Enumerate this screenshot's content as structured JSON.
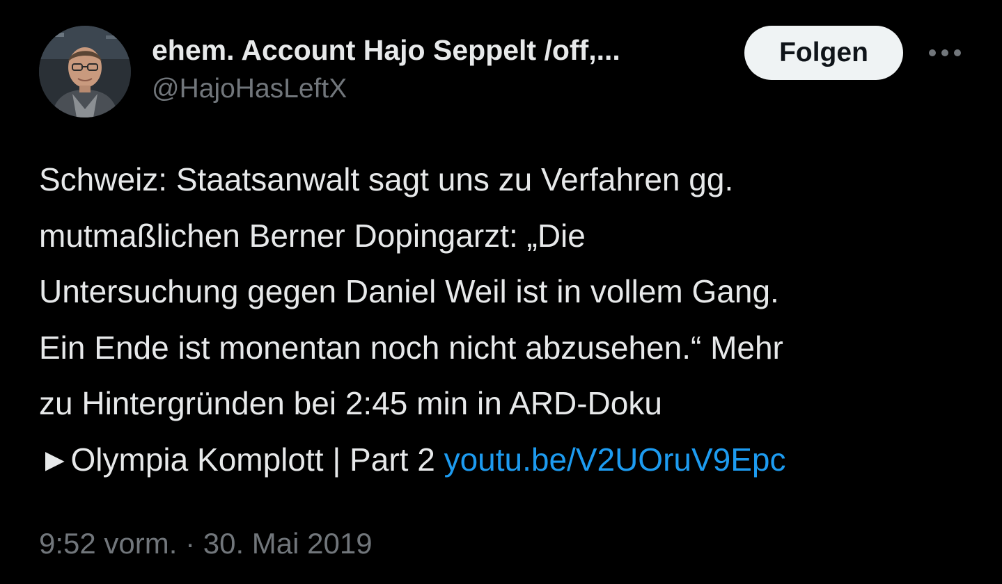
{
  "author": {
    "display_name": "ehem. Account Hajo Seppelt /off,...",
    "handle": "@HajoHasLeftX",
    "avatar_icon": "profile-photo"
  },
  "actions": {
    "follow_label": "Folgen",
    "more_icon": "more-icon"
  },
  "tweet": {
    "lines": [
      "Schweiz: Staatsanwalt sagt uns zu Verfahren gg.",
      "mutmaßlichen Berner Dopingarzt: „Die",
      "Untersuchung gegen Daniel Weil ist in vollem Gang.",
      "Ein Ende ist monentan noch nicht abzusehen.“ Mehr",
      "zu Hintergründen bei 2:45 min in ARD-Doku"
    ],
    "last_line_text": "►Olympia Komplott | Part 2 ",
    "link_text": "youtu.be/V2UOruV9Epc"
  },
  "meta": {
    "time": "9:52 vorm.",
    "separator": " · ",
    "date": "30. Mai 2019"
  },
  "colors": {
    "background": "#000000",
    "text": "#e7e9ea",
    "secondary": "#71767b",
    "link": "#1d9bf0",
    "button_bg": "#eff3f4"
  }
}
